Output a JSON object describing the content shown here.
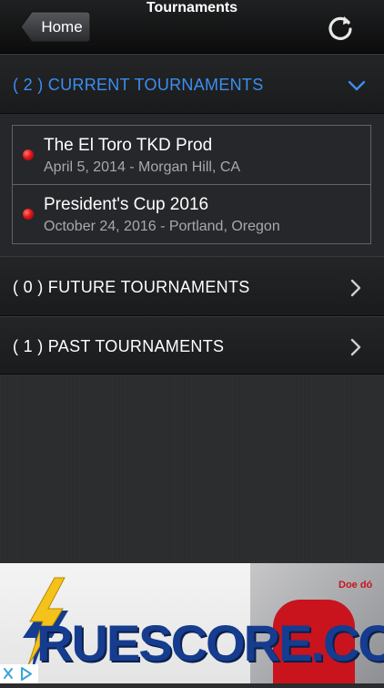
{
  "navbar": {
    "title": "Tournaments",
    "home_label": "Home"
  },
  "sections": {
    "current": {
      "label": "( 2 ) CURRENT TOURNAMENTS",
      "accent": "#3c8ef0"
    },
    "future": {
      "label": "( 0 ) FUTURE TOURNAMENTS"
    },
    "past": {
      "label": "( 1 ) PAST TOURNAMENTS"
    }
  },
  "tournaments": [
    {
      "name": "The El Toro TKD Prod",
      "details": "April 5, 2014 - Morgan Hill, CA",
      "status_color": "#e0151a"
    },
    {
      "name": "President's Cup 2016",
      "details": "October 24, 2016 - Portland, Oregon",
      "status_color": "#e0151a"
    }
  ],
  "ad": {
    "brand": "RUESCORE.COM",
    "vest_logo": "Doe dó"
  },
  "icons": {
    "refresh": "refresh-icon",
    "chevron_down": "chevron-down-icon",
    "chevron_right": "chevron-right-icon",
    "ad_choices": "ad-choices-icon"
  }
}
